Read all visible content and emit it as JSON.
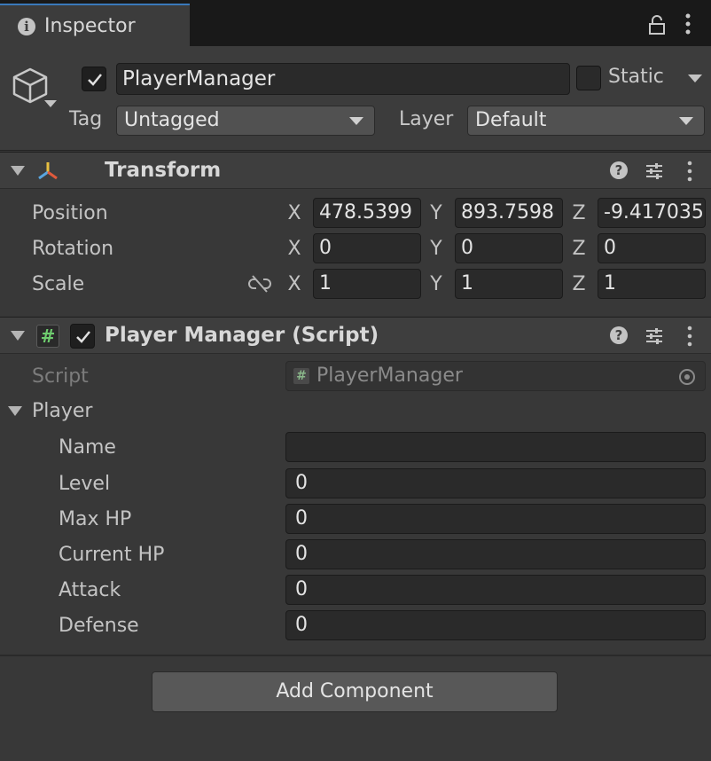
{
  "tab": {
    "title": "Inspector"
  },
  "gameobject": {
    "active": true,
    "name": "PlayerManager",
    "static_label": "Static",
    "static_checked": false,
    "tag_label": "Tag",
    "tag_value": "Untagged",
    "layer_label": "Layer",
    "layer_value": "Default"
  },
  "transform": {
    "title": "Transform",
    "rows": [
      {
        "label": "Position",
        "x": "478.5399",
        "y": "893.7598",
        "z": "-9.417035"
      },
      {
        "label": "Rotation",
        "x": "0",
        "y": "0",
        "z": "0"
      },
      {
        "label": "Scale",
        "x": "1",
        "y": "1",
        "z": "1"
      }
    ],
    "axis": {
      "x": "X",
      "y": "Y",
      "z": "Z"
    }
  },
  "player_manager": {
    "title": "Player Manager (Script)",
    "enabled": true,
    "script_label": "Script",
    "script_value": "PlayerManager",
    "player_foldout": "Player",
    "fields": [
      {
        "label": "Name",
        "value": ""
      },
      {
        "label": "Level",
        "value": "0"
      },
      {
        "label": "Max HP",
        "value": "0"
      },
      {
        "label": "Current HP",
        "value": "0"
      },
      {
        "label": "Attack",
        "value": "0"
      },
      {
        "label": "Defense",
        "value": "0"
      }
    ]
  },
  "add_component_label": "Add Component",
  "colors": {
    "accent": "#3a79bb",
    "background": "#383838",
    "field": "#2a2a2a"
  }
}
